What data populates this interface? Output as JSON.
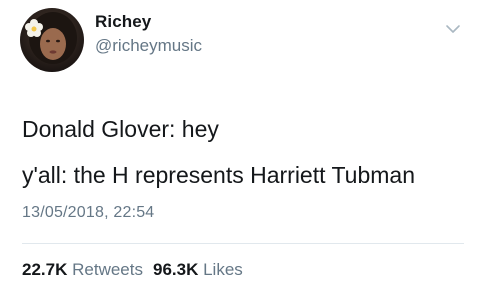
{
  "user": {
    "display_name": "Richey",
    "handle": "@richeymusic"
  },
  "tweet": {
    "lines": [
      "Donald Glover: hey",
      "y'all: the H represents Harriett Tubman"
    ],
    "timestamp": "13/05/2018, 22:54"
  },
  "stats": {
    "retweets_count": "22.7K",
    "retweets_label": "Retweets",
    "likes_count": "96.3K",
    "likes_label": "Likes"
  },
  "icons": {
    "menu": "chevron-down-icon",
    "avatar": "profile-avatar"
  },
  "colors": {
    "text_primary": "#14171a",
    "text_secondary": "#657786",
    "divider": "#e1e8ed"
  }
}
